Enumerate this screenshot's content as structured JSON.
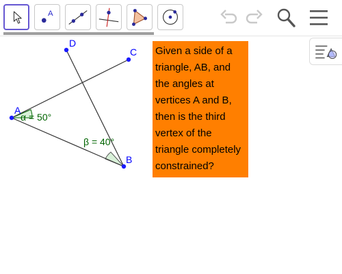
{
  "toolbar": {
    "tools": [
      {
        "name": "move-tool",
        "label": "Move"
      },
      {
        "name": "point-tool",
        "label": "A"
      },
      {
        "name": "line-tool",
        "label": "Line"
      },
      {
        "name": "perpendicular-line-tool",
        "label": "Perpendicular Line"
      },
      {
        "name": "polygon-tool",
        "label": "Polygon"
      },
      {
        "name": "circle-tool",
        "label": "Circle"
      }
    ],
    "undo_icon": "undo-icon",
    "redo_icon": "redo-icon",
    "search_icon": "search-icon",
    "menu_icon": "hamburger-menu-icon"
  },
  "construction": {
    "points": {
      "A": "A",
      "B": "B",
      "C": "C",
      "D": "D"
    },
    "angle_alpha": "α = 50°",
    "angle_beta": "β = 40°"
  },
  "note": {
    "text": "Given a side of a triangle, AB, and the angles at vertices A and B, then is the third vertex of the triangle completely constrained?"
  },
  "colors": {
    "accent": "#6557d2",
    "point": "#1a1aff",
    "point_label": "#0000ff",
    "angle_label": "#006400",
    "note_background": "#ff7f00"
  }
}
